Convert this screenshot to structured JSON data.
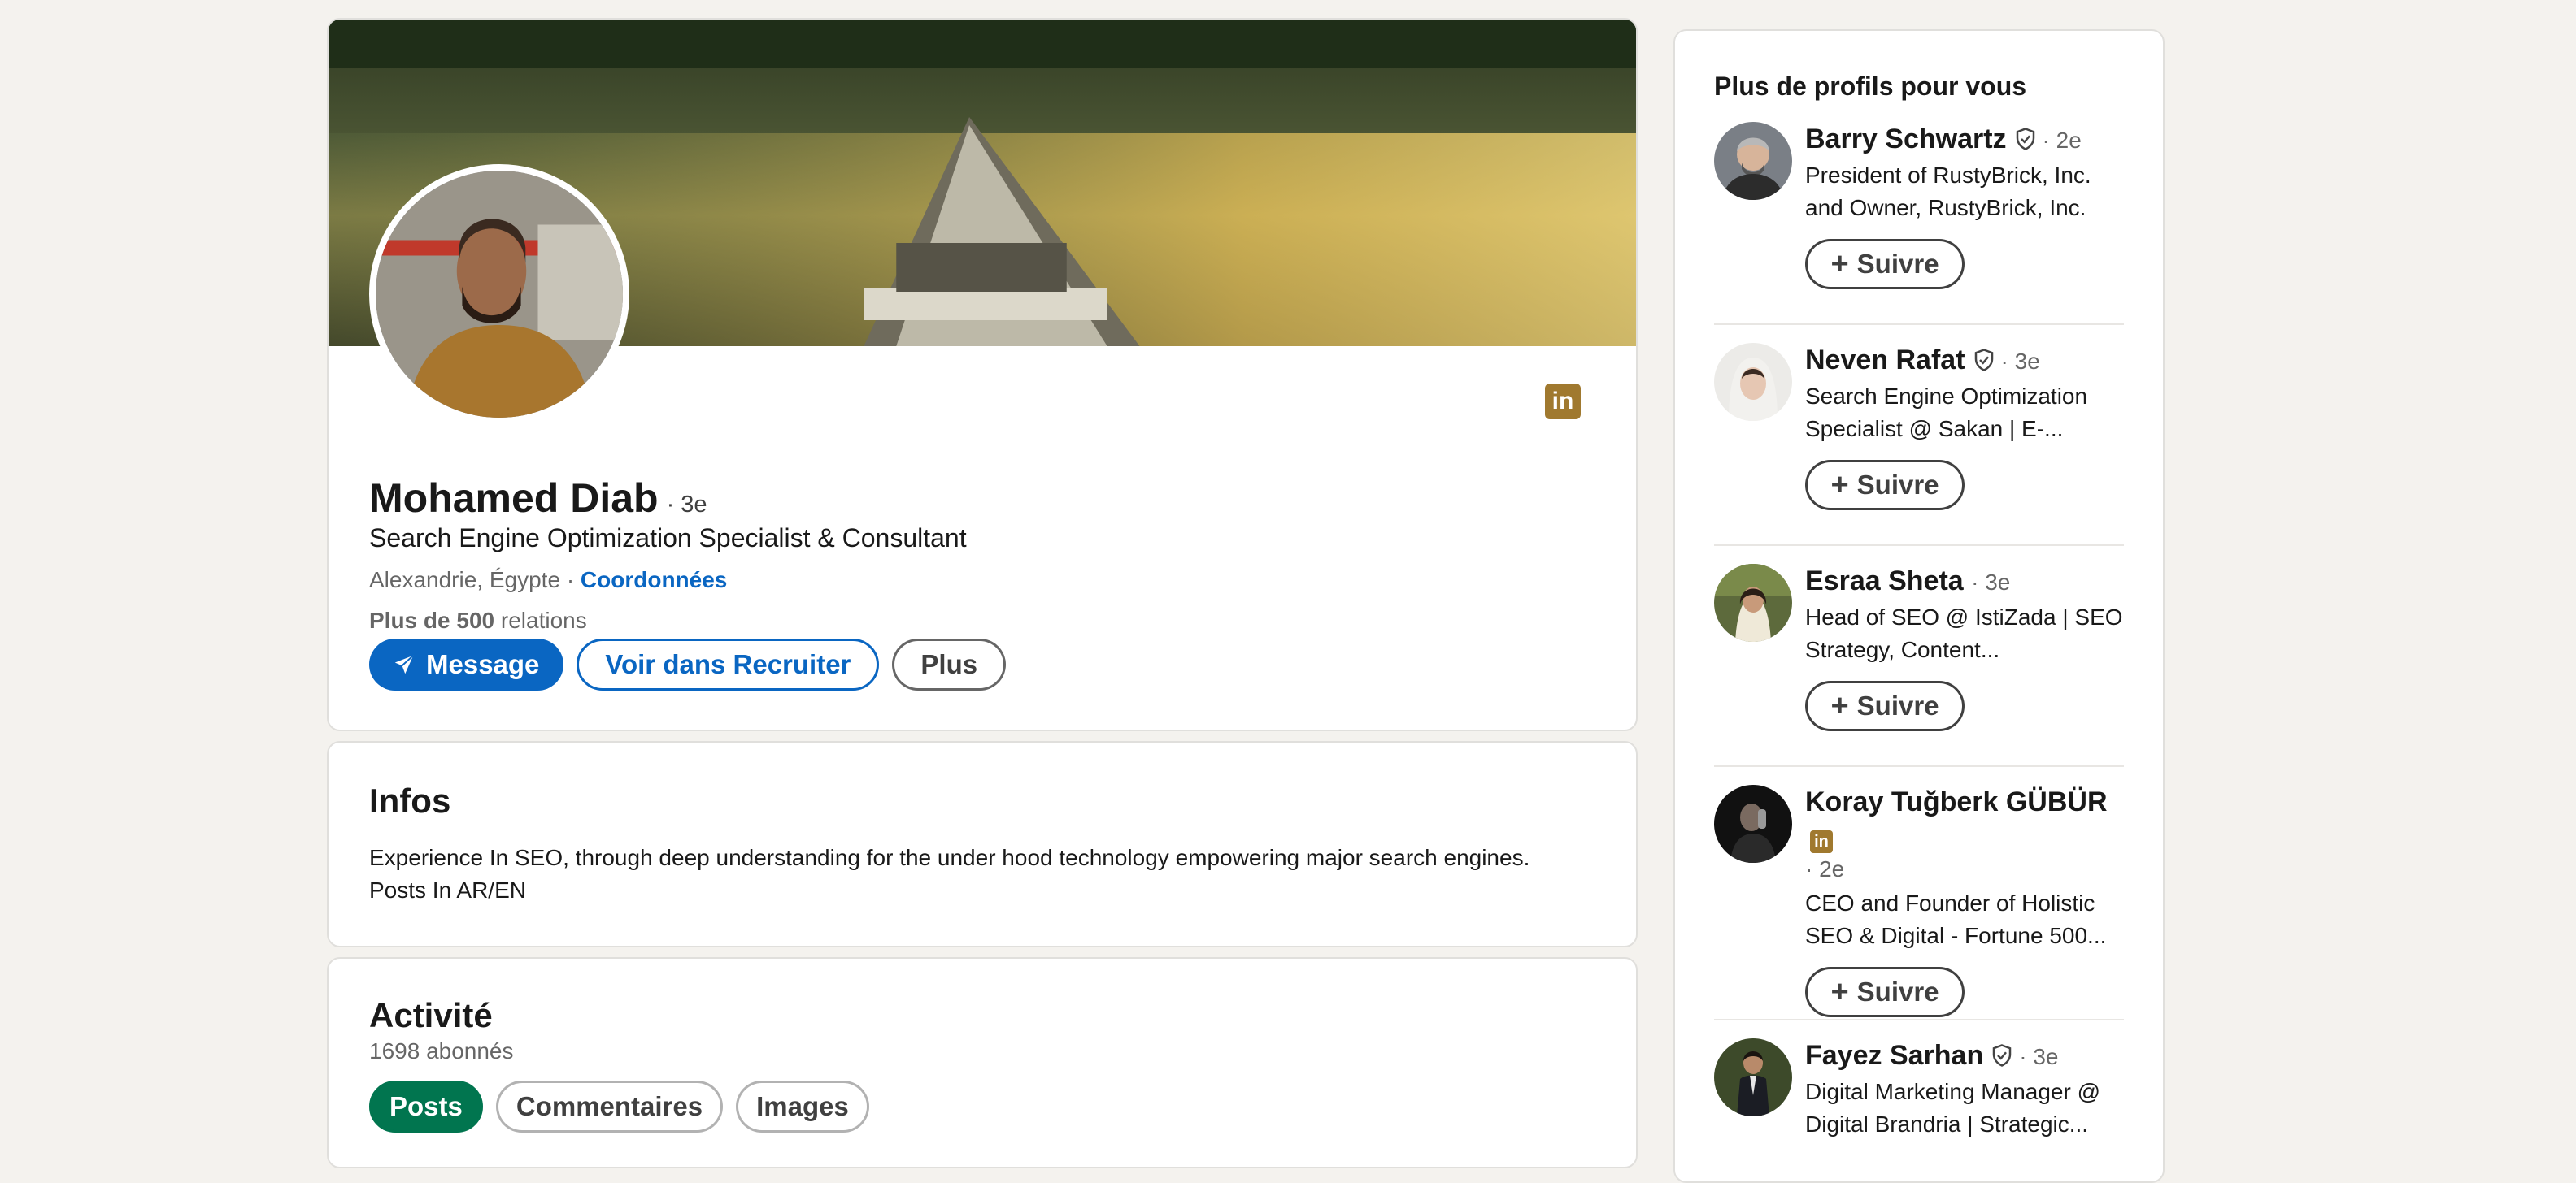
{
  "profile": {
    "name": "Mohamed Diab",
    "degree": "· 3e",
    "headline": "Search Engine Optimization Specialist & Consultant",
    "location": "Alexandrie, Égypte · ",
    "contact_link": "Coordonnées",
    "connections_bold": "Plus de 500",
    "connections_rest": " relations",
    "linkedin_badge": "in",
    "buttons": {
      "message": "Message",
      "recruiter": "Voir dans Recruiter",
      "more": "Plus"
    }
  },
  "about": {
    "title": "Infos",
    "text_line1": "Experience In SEO, through deep understanding for the under hood technology empowering major search engines.",
    "text_line2": "Posts In AR/EN"
  },
  "activity": {
    "title": "Activité",
    "followers": "1698 abonnés",
    "tabs": [
      "Posts",
      "Commentaires",
      "Images"
    ]
  },
  "sidebar": {
    "title": "Plus de profils pour vous",
    "follow_label": "Suivre",
    "people": [
      {
        "name": "Barry Schwartz",
        "verified": true,
        "degree": "· 2e",
        "headline_line1": "President of RustyBrick, Inc.",
        "headline_line2": "and Owner, RustyBrick, Inc."
      },
      {
        "name": "Neven Rafat",
        "verified": true,
        "degree": "· 3e",
        "headline_line1": "Search Engine Optimization",
        "headline_line2": "Specialist @ Sakan | E-..."
      },
      {
        "name": "Esraa Sheta",
        "verified": false,
        "degree": "· 3e",
        "headline_line1": "Head of SEO @ IstiZada | SEO",
        "headline_line2": "Strategy, Content..."
      },
      {
        "name": "Koray Tuğberk GÜBÜR",
        "verified": false,
        "badge": "in",
        "degree": "· 2e",
        "headline_line1": "CEO and Founder of Holistic",
        "headline_line2": "SEO & Digital - Fortune 500..."
      },
      {
        "name": "Fayez Sarhan",
        "verified": true,
        "degree": "· 3e",
        "headline_line1": "Digital Marketing Manager @",
        "headline_line2": "Digital Brandria | Strategic..."
      }
    ]
  },
  "colors": {
    "primary": "#0a66c2",
    "active_tab": "#01754f",
    "premium_badge": "#a0792f",
    "background": "#f4f2ee"
  }
}
